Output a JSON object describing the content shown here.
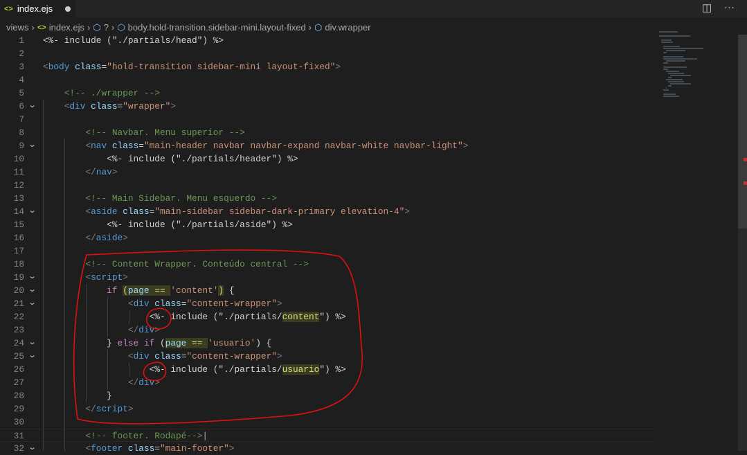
{
  "tab": {
    "title": "index.ejs",
    "icon": "<>"
  },
  "toolbar": {
    "split": "◫",
    "more": "···"
  },
  "breadcrumb": [
    "views",
    "index.ejs",
    "?",
    "body.hold-transition.sidebar-mini.layout-fixed",
    "div.wrapper"
  ],
  "colors": {
    "annotation": "#e01010",
    "accent": "#569cd6"
  },
  "cursor_line": 31,
  "lines": [
    {
      "n": "1",
      "f": false,
      "tk": [
        [
          "d",
          "<%-"
        ],
        [
          "t",
          " include (\"./partials/head\") "
        ],
        [
          "d",
          "%>"
        ]
      ]
    },
    {
      "n": "2",
      "f": false,
      "tk": []
    },
    {
      "n": "3",
      "f": false,
      "tk": [
        [
          "p",
          "<"
        ],
        [
          "n",
          "body"
        ],
        [
          "t",
          " "
        ],
        [
          "a",
          "class"
        ],
        [
          "t",
          "="
        ],
        [
          "s",
          "\"hold-transition sidebar-mini layout-fixed\""
        ],
        [
          "p",
          ">"
        ]
      ]
    },
    {
      "n": "4",
      "f": false,
      "tk": []
    },
    {
      "n": "5",
      "f": false,
      "tk": [
        [
          "t",
          "    "
        ],
        [
          "c",
          "<!-- ./wrapper -->"
        ]
      ]
    },
    {
      "n": "6",
      "f": true,
      "tk": [
        [
          "t",
          "    "
        ],
        [
          "p",
          "<"
        ],
        [
          "n",
          "div"
        ],
        [
          "t",
          " "
        ],
        [
          "a",
          "class"
        ],
        [
          "t",
          "="
        ],
        [
          "s",
          "\"wrapper\""
        ],
        [
          "p",
          ">"
        ]
      ]
    },
    {
      "n": "7",
      "f": false,
      "tk": []
    },
    {
      "n": "8",
      "f": false,
      "tk": [
        [
          "t",
          "        "
        ],
        [
          "c",
          "<!-- Navbar. Menu superior -->"
        ]
      ]
    },
    {
      "n": "9",
      "f": true,
      "tk": [
        [
          "t",
          "        "
        ],
        [
          "p",
          "<"
        ],
        [
          "n",
          "nav"
        ],
        [
          "t",
          " "
        ],
        [
          "a",
          "class"
        ],
        [
          "t",
          "="
        ],
        [
          "s",
          "\"main-header navbar navbar-expand navbar-white navbar-light\""
        ],
        [
          "p",
          ">"
        ]
      ]
    },
    {
      "n": "10",
      "f": false,
      "tk": [
        [
          "t",
          "            "
        ],
        [
          "d",
          "<%-"
        ],
        [
          "t",
          " include (\"./partials/header\") "
        ],
        [
          "d",
          "%>"
        ]
      ]
    },
    {
      "n": "11",
      "f": false,
      "tk": [
        [
          "t",
          "        "
        ],
        [
          "p",
          "</"
        ],
        [
          "n",
          "nav"
        ],
        [
          "p",
          ">"
        ]
      ]
    },
    {
      "n": "12",
      "f": false,
      "tk": []
    },
    {
      "n": "13",
      "f": false,
      "tk": [
        [
          "t",
          "        "
        ],
        [
          "c",
          "<!-- Main Sidebar. Menu esquerdo -->"
        ]
      ]
    },
    {
      "n": "14",
      "f": true,
      "tk": [
        [
          "t",
          "        "
        ],
        [
          "p",
          "<"
        ],
        [
          "n",
          "aside"
        ],
        [
          "t",
          " "
        ],
        [
          "a",
          "class"
        ],
        [
          "t",
          "="
        ],
        [
          "s",
          "\"main-sidebar sidebar-dark-primary elevation-4\""
        ],
        [
          "p",
          ">"
        ]
      ]
    },
    {
      "n": "15",
      "f": false,
      "tk": [
        [
          "t",
          "            "
        ],
        [
          "d",
          "<%-"
        ],
        [
          "t",
          " include (\"./partials/aside\") "
        ],
        [
          "d",
          "%>"
        ]
      ]
    },
    {
      "n": "16",
      "f": false,
      "tk": [
        [
          "t",
          "        "
        ],
        [
          "p",
          "</"
        ],
        [
          "n",
          "aside"
        ],
        [
          "p",
          ">"
        ]
      ]
    },
    {
      "n": "17",
      "f": false,
      "tk": []
    },
    {
      "n": "18",
      "f": false,
      "tk": [
        [
          "t",
          "        "
        ],
        [
          "c",
          "<!-- Content Wrapper. Conteúdo central -->"
        ]
      ]
    },
    {
      "n": "19",
      "f": true,
      "tk": [
        [
          "t",
          "        "
        ],
        [
          "p",
          "<"
        ],
        [
          "n",
          "script"
        ],
        [
          "p",
          ">"
        ]
      ]
    },
    {
      "n": "20",
      "f": true,
      "tk": [
        [
          "t",
          "            "
        ],
        [
          "k",
          "if"
        ],
        [
          "t",
          " "
        ],
        [
          "h",
          "("
        ],
        [
          "v",
          "page"
        ],
        [
          "h",
          " == "
        ],
        [
          "s",
          "'content'"
        ],
        [
          "h",
          ")"
        ],
        [
          "t",
          " {"
        ]
      ]
    },
    {
      "n": "21",
      "f": true,
      "tk": [
        [
          "t",
          "                "
        ],
        [
          "p",
          "<"
        ],
        [
          "n",
          "div"
        ],
        [
          "t",
          " "
        ],
        [
          "a",
          "class"
        ],
        [
          "t",
          "="
        ],
        [
          "s",
          "\"content-wrapper\""
        ],
        [
          "p",
          ">"
        ]
      ]
    },
    {
      "n": "22",
      "f": false,
      "tk": [
        [
          "t",
          "                    "
        ],
        [
          "d",
          "<%-"
        ],
        [
          "t",
          " include (\"./partials/"
        ],
        [
          "h",
          "content"
        ],
        [
          "t",
          "\") "
        ],
        [
          "d",
          "%>"
        ]
      ]
    },
    {
      "n": "23",
      "f": false,
      "tk": [
        [
          "t",
          "                "
        ],
        [
          "p",
          "</"
        ],
        [
          "n",
          "div"
        ],
        [
          "p",
          ">"
        ]
      ]
    },
    {
      "n": "24",
      "f": true,
      "tk": [
        [
          "t",
          "            } "
        ],
        [
          "k",
          "else if"
        ],
        [
          "t",
          " ("
        ],
        [
          "v",
          "page"
        ],
        [
          "h",
          " == "
        ],
        [
          "s",
          "'usuario'"
        ],
        [
          "t",
          ") {"
        ]
      ]
    },
    {
      "n": "25",
      "f": true,
      "tk": [
        [
          "t",
          "                "
        ],
        [
          "p",
          "<"
        ],
        [
          "n",
          "div"
        ],
        [
          "t",
          " "
        ],
        [
          "a",
          "class"
        ],
        [
          "t",
          "="
        ],
        [
          "s",
          "\"content-wrapper\""
        ],
        [
          "p",
          ">"
        ]
      ]
    },
    {
      "n": "26",
      "f": false,
      "tk": [
        [
          "t",
          "                    "
        ],
        [
          "d",
          "<%-"
        ],
        [
          "t",
          " include (\"./partials/"
        ],
        [
          "h",
          "usuario"
        ],
        [
          "t",
          "\") "
        ],
        [
          "d",
          "%>"
        ]
      ]
    },
    {
      "n": "27",
      "f": false,
      "tk": [
        [
          "t",
          "                "
        ],
        [
          "p",
          "</"
        ],
        [
          "n",
          "div"
        ],
        [
          "p",
          ">"
        ]
      ]
    },
    {
      "n": "28",
      "f": false,
      "tk": [
        [
          "t",
          "            }"
        ]
      ]
    },
    {
      "n": "29",
      "f": false,
      "tk": [
        [
          "t",
          "        "
        ],
        [
          "p",
          "</"
        ],
        [
          "n",
          "script"
        ],
        [
          "p",
          ">"
        ]
      ]
    },
    {
      "n": "30",
      "f": false,
      "tk": []
    },
    {
      "n": "31",
      "f": false,
      "tk": [
        [
          "t",
          "        "
        ],
        [
          "c",
          "<!-- footer. Rodapé-->"
        ]
      ]
    },
    {
      "n": "32",
      "f": true,
      "tk": [
        [
          "t",
          "        "
        ],
        [
          "p",
          "<"
        ],
        [
          "n",
          "footer"
        ],
        [
          "t",
          " "
        ],
        [
          "a",
          "class"
        ],
        [
          "t",
          "="
        ],
        [
          "s",
          "\"main-footer\""
        ],
        [
          "p",
          ">"
        ]
      ]
    }
  ]
}
